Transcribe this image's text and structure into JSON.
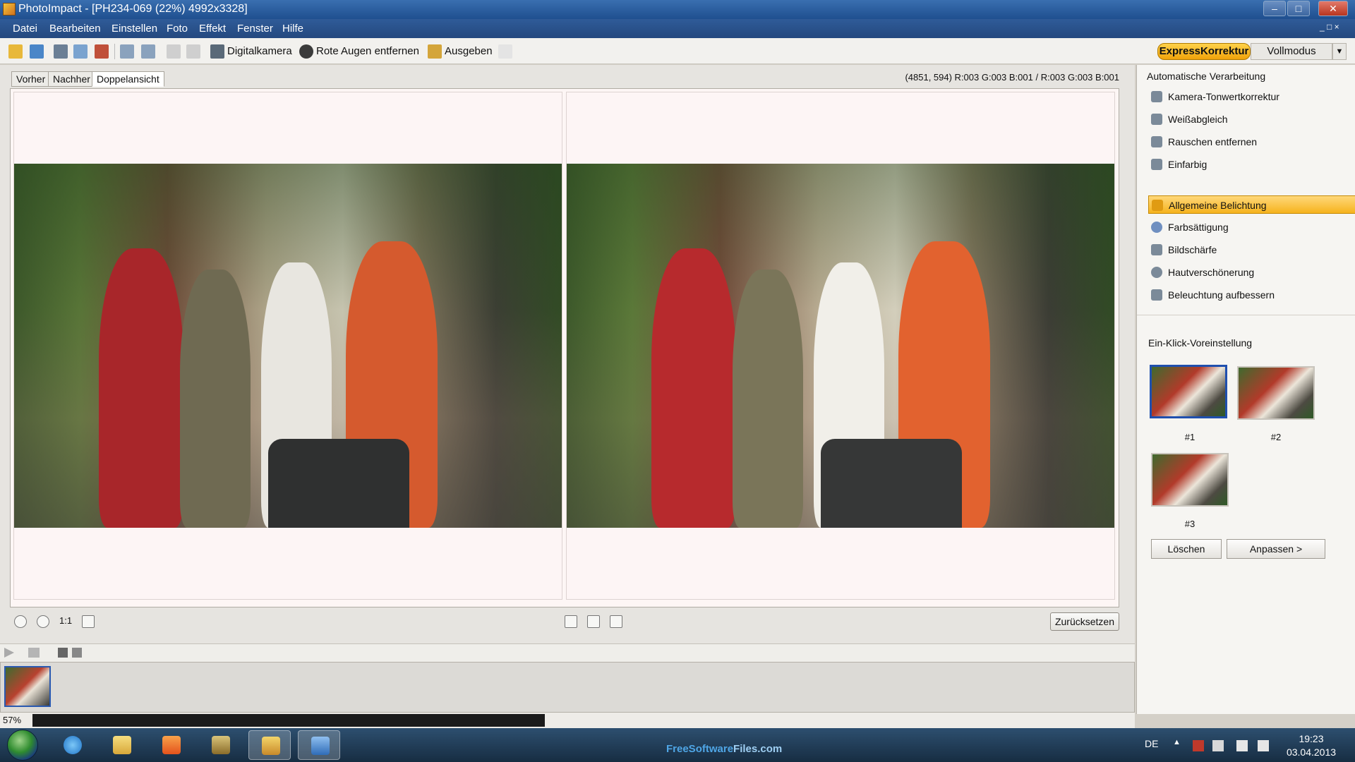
{
  "window": {
    "title": "PhotoImpact - [PH234-069 (22%) 4992x3328]",
    "controls": {
      "minimize": "–",
      "maximize": "□",
      "close": "✕"
    }
  },
  "menu": {
    "items": [
      "Datei",
      "Bearbeiten",
      "Einstellen",
      "Foto",
      "Effekt",
      "Fenster",
      "Hilfe"
    ],
    "doc_controls": "_ □ ×"
  },
  "toolbar": {
    "digitalkamera": "Digitalkamera",
    "rote_augen": "Rote Augen entfernen",
    "ausgeben": "Ausgeben"
  },
  "modes": {
    "express": "ExpressKorrektur",
    "full": "Vollmodus",
    "dropdown": "▼"
  },
  "view_tabs": [
    "Vorher",
    "Nachher",
    "Doppelansicht"
  ],
  "active_tab": "Doppelansicht",
  "coords": "(4851, 594) R:003 G:003 B:001 / R:003 G:003 B:001",
  "zoom_controls": {
    "actual_size": "1:1"
  },
  "reset_button": "Zurücksetzen",
  "status": {
    "zoom": "57%",
    "progress": 0.68
  },
  "side": {
    "auto_heading": "Automatische Verarbeitung",
    "auto_items": [
      "Kamera-Tonwertkorrektur",
      "Weißabgleich",
      "Rauschen entfernen",
      "Einfarbig"
    ],
    "manual_items": [
      "Allgemeine Belichtung",
      "Farbsättigung",
      "Bildschärfe",
      "Hautverschönerung",
      "Beleuchtung aufbessern"
    ],
    "selected_item": "Allgemeine Belichtung",
    "presets_heading": "Ein-Klick-Voreinstellung",
    "presets": [
      "#1",
      "#2",
      "#3"
    ],
    "delete_btn": "Löschen",
    "adjust_btn": "Anpassen >"
  },
  "taskbar": {
    "watermark_a": "FreeSoftware",
    "watermark_b": "Files.com",
    "lang": "DE",
    "tray_arrow": "▲",
    "time": "19:23",
    "date": "03.04.2013"
  },
  "colors": {
    "accent_selected": "#f6b31d",
    "title_blue": "#1f4f8f",
    "preset_selected_border": "#1f4fae"
  }
}
